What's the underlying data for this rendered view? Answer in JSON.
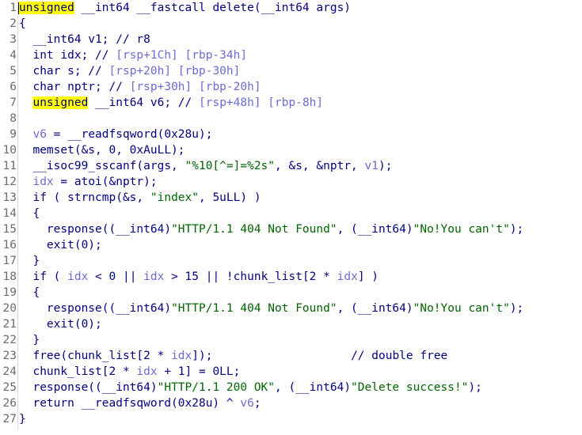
{
  "editor": {
    "lines": [
      {
        "num": "1",
        "segments": [
          {
            "t": "unsigned",
            "c": "hl"
          },
          {
            "t": " __int64 __fastcall delete(__int64 args)",
            "c": "pl"
          }
        ]
      },
      {
        "num": "2",
        "segments": [
          {
            "t": "{",
            "c": "pl"
          }
        ]
      },
      {
        "num": "3",
        "segments": [
          {
            "t": "  __int64 v1; // r8",
            "c": "pl"
          }
        ]
      },
      {
        "num": "4",
        "segments": [
          {
            "t": "  int idx; // ",
            "c": "pl"
          },
          {
            "t": "[rsp+1Ch] [rbp-34h]",
            "c": "var"
          }
        ]
      },
      {
        "num": "5",
        "segments": [
          {
            "t": "  char s; // ",
            "c": "pl"
          },
          {
            "t": "[rsp+20h] [rbp-30h]",
            "c": "var"
          }
        ]
      },
      {
        "num": "6",
        "segments": [
          {
            "t": "  char nptr; // ",
            "c": "pl"
          },
          {
            "t": "[rsp+30h] [rbp-20h]",
            "c": "var"
          }
        ]
      },
      {
        "num": "7",
        "segments": [
          {
            "t": "  ",
            "c": "pl"
          },
          {
            "t": "unsigned",
            "c": "hl"
          },
          {
            "t": " __int64 v6; // ",
            "c": "pl"
          },
          {
            "t": "[rsp+48h] [rbp-8h]",
            "c": "var"
          }
        ]
      },
      {
        "num": "8",
        "segments": []
      },
      {
        "num": "9",
        "segments": [
          {
            "t": "  ",
            "c": "pl"
          },
          {
            "t": "v6",
            "c": "var"
          },
          {
            "t": " = __readfsqword(0x28u);",
            "c": "pl"
          }
        ]
      },
      {
        "num": "10",
        "segments": [
          {
            "t": "  memset(&s, 0, 0xAuLL);",
            "c": "pl"
          }
        ]
      },
      {
        "num": "11",
        "segments": [
          {
            "t": "  __isoc99_sscanf(args, ",
            "c": "pl"
          },
          {
            "t": "\"%10[^=]=%2s\"",
            "c": "str"
          },
          {
            "t": ", &s, &nptr, ",
            "c": "pl"
          },
          {
            "t": "v1",
            "c": "var"
          },
          {
            "t": ");",
            "c": "pl"
          }
        ]
      },
      {
        "num": "12",
        "segments": [
          {
            "t": "  ",
            "c": "pl"
          },
          {
            "t": "idx",
            "c": "var"
          },
          {
            "t": " = atoi(&nptr);",
            "c": "pl"
          }
        ]
      },
      {
        "num": "13",
        "segments": [
          {
            "t": "  if ( strncmp(&s, ",
            "c": "pl"
          },
          {
            "t": "\"index\"",
            "c": "str"
          },
          {
            "t": ", 5uLL) )",
            "c": "pl"
          }
        ]
      },
      {
        "num": "14",
        "segments": [
          {
            "t": "  {",
            "c": "pl"
          }
        ]
      },
      {
        "num": "15",
        "segments": [
          {
            "t": "    response((__int64)",
            "c": "pl"
          },
          {
            "t": "\"HTTP/1.1 404 Not Found\"",
            "c": "str"
          },
          {
            "t": ", (__int64)",
            "c": "pl"
          },
          {
            "t": "\"No!You can't\"",
            "c": "str"
          },
          {
            "t": ");",
            "c": "pl"
          }
        ]
      },
      {
        "num": "16",
        "segments": [
          {
            "t": "    exit(0);",
            "c": "pl"
          }
        ]
      },
      {
        "num": "17",
        "segments": [
          {
            "t": "  }",
            "c": "pl"
          }
        ]
      },
      {
        "num": "18",
        "segments": [
          {
            "t": "  if ( ",
            "c": "pl"
          },
          {
            "t": "idx",
            "c": "var"
          },
          {
            "t": " < 0 || ",
            "c": "pl"
          },
          {
            "t": "idx",
            "c": "var"
          },
          {
            "t": " > 15 || !chunk_list[2 * ",
            "c": "pl"
          },
          {
            "t": "idx",
            "c": "var"
          },
          {
            "t": "] )",
            "c": "pl"
          }
        ]
      },
      {
        "num": "19",
        "segments": [
          {
            "t": "  {",
            "c": "pl"
          }
        ]
      },
      {
        "num": "20",
        "segments": [
          {
            "t": "    response((__int64)",
            "c": "pl"
          },
          {
            "t": "\"HTTP/1.1 404 Not Found\"",
            "c": "str"
          },
          {
            "t": ", (__int64)",
            "c": "pl"
          },
          {
            "t": "\"No!You can't\"",
            "c": "str"
          },
          {
            "t": ");",
            "c": "pl"
          }
        ]
      },
      {
        "num": "21",
        "segments": [
          {
            "t": "    exit(0);",
            "c": "pl"
          }
        ]
      },
      {
        "num": "22",
        "segments": [
          {
            "t": "  }",
            "c": "pl"
          }
        ]
      },
      {
        "num": "23",
        "segments": [
          {
            "t": "  free(chunk_list[2 * ",
            "c": "pl"
          },
          {
            "t": "idx",
            "c": "var"
          },
          {
            "t": "]);                    ",
            "c": "pl"
          },
          {
            "t": "// double free",
            "c": "cm"
          }
        ]
      },
      {
        "num": "24",
        "segments": [
          {
            "t": "  chunk_list[2 * ",
            "c": "pl"
          },
          {
            "t": "idx",
            "c": "var"
          },
          {
            "t": " + 1] = 0LL;",
            "c": "pl"
          }
        ]
      },
      {
        "num": "25",
        "segments": [
          {
            "t": "  response((__int64)",
            "c": "pl"
          },
          {
            "t": "\"HTTP/1.1 200 OK\"",
            "c": "str"
          },
          {
            "t": ", (__int64)",
            "c": "pl"
          },
          {
            "t": "\"Delete success!\"",
            "c": "str"
          },
          {
            "t": ");",
            "c": "pl"
          }
        ]
      },
      {
        "num": "26",
        "segments": [
          {
            "t": "  return __readfsqword(0x28u) ^ ",
            "c": "pl"
          },
          {
            "t": "v6",
            "c": "var"
          },
          {
            "t": ";",
            "c": "pl"
          }
        ]
      },
      {
        "num": "27",
        "segments": [
          {
            "t": "}",
            "c": "pl"
          }
        ]
      }
    ]
  }
}
